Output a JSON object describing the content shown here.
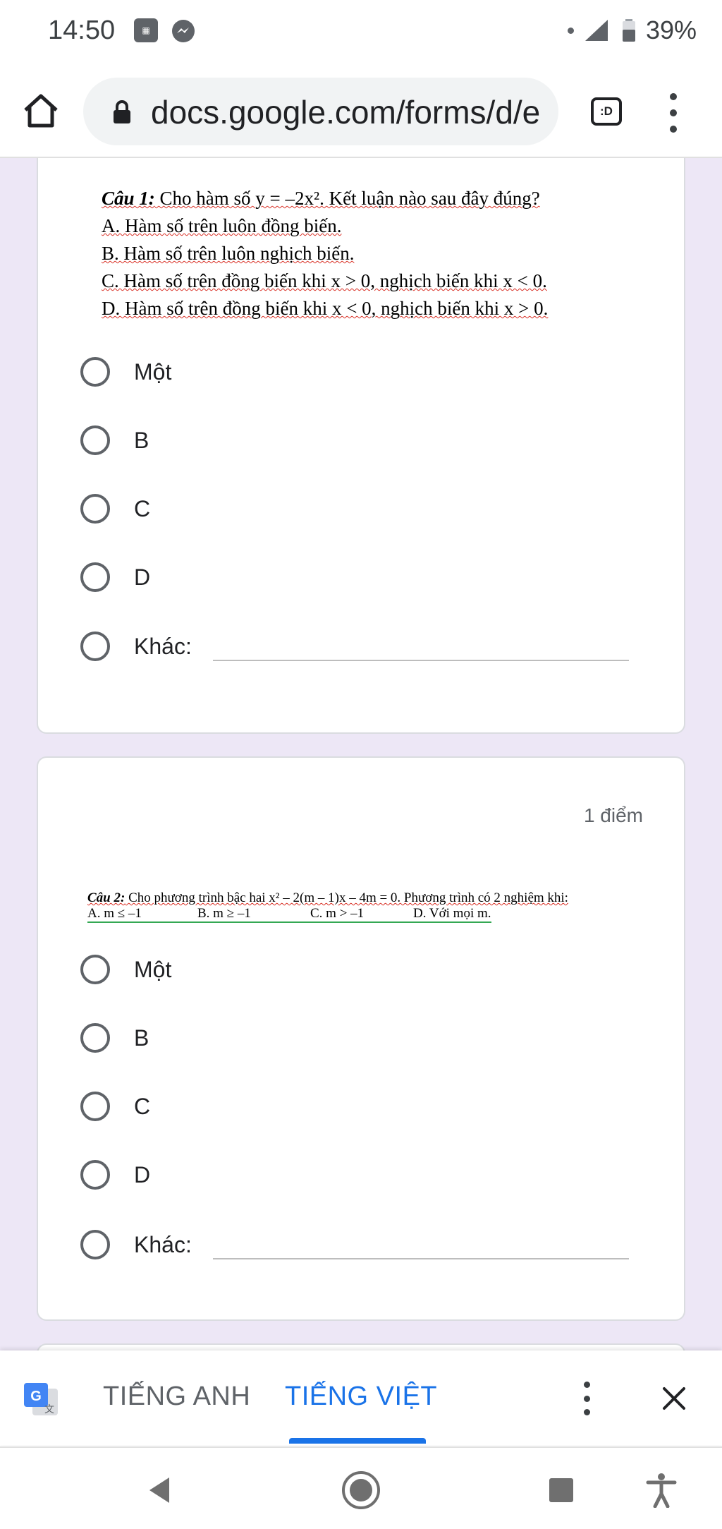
{
  "status_bar": {
    "time": "14:50",
    "battery": "39%"
  },
  "browser": {
    "url": "docs.google.com/forms/d/e",
    "tab_label": ":D"
  },
  "question1": {
    "head": "Câu 1:",
    "prompt": " Cho hàm số y = –2x². Kết luận nào sau đây đúng?",
    "line_a": "A. Hàm số trên luôn đồng biến.",
    "line_b": "B. Hàm số trên luôn nghịch  biến.",
    "line_c": "C. Hàm số trên  đồng biến khi x > 0, nghịch biến khi x < 0.",
    "line_d": "D. Hàm số trên  đồng biến khi x < 0, nghịch biến khi x > 0.",
    "options": [
      "Một",
      "B",
      "C",
      "D",
      "Khác:"
    ]
  },
  "question2": {
    "points": "1 điểm",
    "head": "Câu 2:",
    "prompt": " Cho phương trình bậc hai x² – 2(m – 1)x – 4m = 0. Phương trình có 2 nghiệm khi:",
    "choice_a": "A. m ≤ –1",
    "choice_b": "B. m ≥ –1",
    "choice_c": "C. m > –1",
    "choice_d": "D. Với mọi m.",
    "options": [
      "Một",
      "B",
      "C",
      "D",
      "Khác:"
    ]
  },
  "translate_bar": {
    "lang_source": "TIẾNG ANH",
    "lang_target": "TIẾNG VIỆT"
  },
  "colors": {
    "accent": "#1a73e8",
    "page_bg": "#ede7f6"
  }
}
